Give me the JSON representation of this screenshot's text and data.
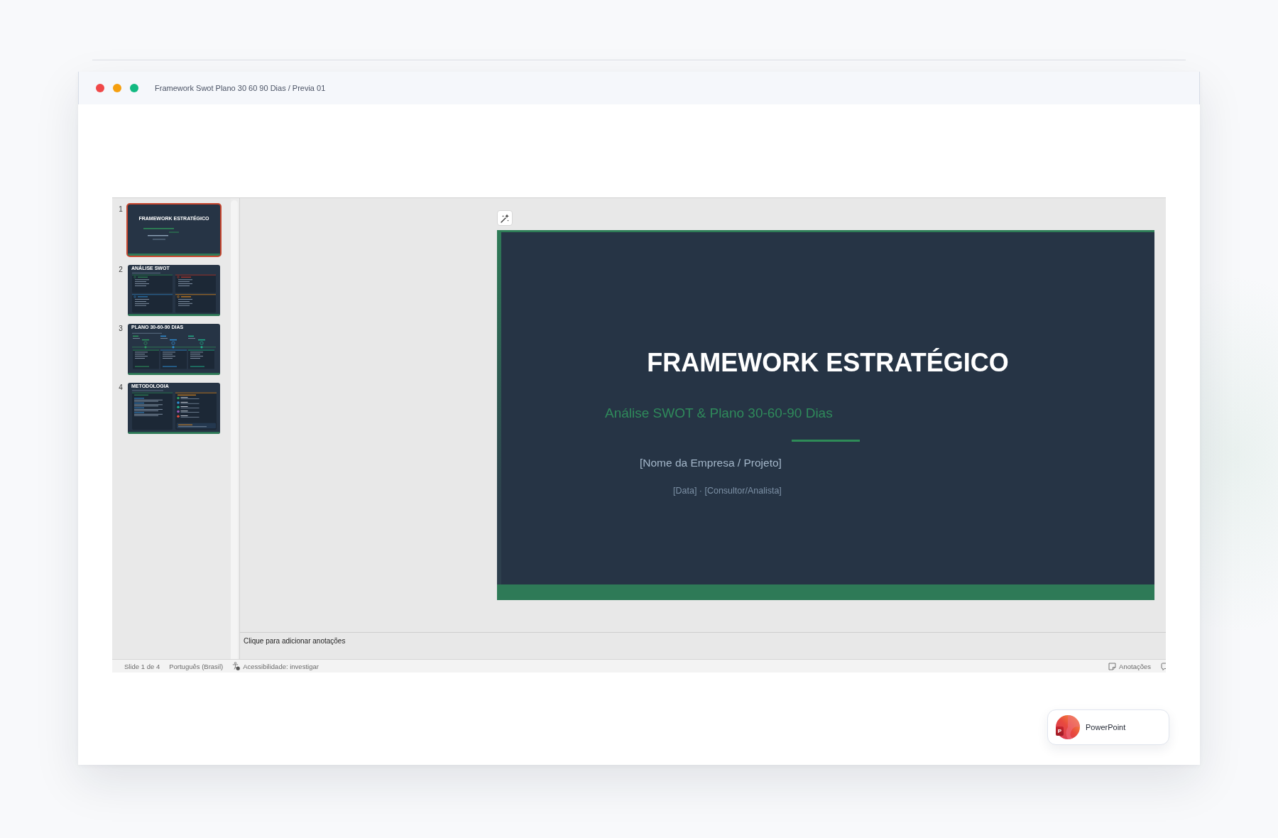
{
  "window": {
    "title": "Framework Swot Plano 30 60 90 Dias / Previa 01"
  },
  "thumbnails": [
    {
      "number": "1",
      "title": "FRAMEWORK ESTRATÉGICO",
      "kind": "title",
      "selected": true
    },
    {
      "number": "2",
      "title": "ANÁLISE SWOT",
      "kind": "swot",
      "selected": false
    },
    {
      "number": "3",
      "title": "PLANO 30-60-90 DIAS",
      "kind": "timeline",
      "selected": false
    },
    {
      "number": "4",
      "title": "METODOLOGIA",
      "kind": "method",
      "selected": false
    }
  ],
  "slide": {
    "title": "FRAMEWORK ESTRATÉGICO",
    "subtitle": "Análise SWOT & Plano 30-60-90 Dias",
    "company": "[Nome da Empresa / Projeto]",
    "details": "[Data] · [Consultor/Analista]"
  },
  "notes": {
    "placeholder": "Clique para adicionar anotações"
  },
  "status_bar": {
    "slide_position": "Slide 1 de 4",
    "language": "Português (Brasil)",
    "accessibility": "Acessibilidade: investigar",
    "notes_button": "Anotações"
  },
  "app_badge": {
    "logo_letter": "P",
    "name": "PowerPoint"
  }
}
